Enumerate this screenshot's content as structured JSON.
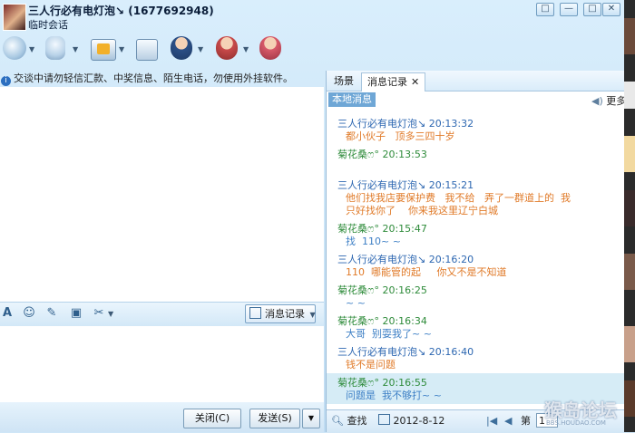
{
  "window": {
    "title": "三人行必有电灯泡↘ (1677692948)",
    "subtitle": "临时会话",
    "controls": [
      "□",
      "—",
      "□",
      "✕"
    ]
  },
  "toolbar": {
    "icons": [
      "video-call-icon",
      "voice-call-icon",
      "transfer-file-icon",
      "app-icon",
      "police-icon",
      "block-user-icon",
      "add-friend-icon"
    ]
  },
  "left": {
    "notice": "交谈中请勿轻信汇款、中奖信息、陌生电话，勿使用外挂软件。",
    "format_icons": [
      "A",
      "☺",
      "✎",
      "▣",
      "✂"
    ],
    "message_record_button": "消息记录",
    "close_button": "关闭(C)",
    "send_button": "发送(S)"
  },
  "right": {
    "tabs": [
      "场景",
      "消息记录"
    ],
    "tab_close": "✕",
    "local_tag": "本地消息",
    "more": "更多",
    "messages": [
      {
        "sender": "三人行必有电灯泡↘",
        "time": "20:13:32",
        "text": "都小伙子   顶多三四十岁",
        "who": "me"
      },
      {
        "sender": "菊花桑ෆ°",
        "time": "20:13:53",
        "text": "",
        "who": "other"
      },
      {
        "sender": "三人行必有电灯泡↘",
        "time": "20:15:21",
        "text": "他们找我店要保护费   我不给   弄了一群道上的  我\n只好找你了    你来我这里辽宁白城",
        "who": "me"
      },
      {
        "sender": "菊花桑ෆ°",
        "time": "20:15:47",
        "text": "找  110~ ~",
        "who": "other"
      },
      {
        "sender": "三人行必有电灯泡↘",
        "time": "20:16:20",
        "text": "110  哪能管的起     你又不是不知道",
        "who": "me"
      },
      {
        "sender": "菊花桑ෆ°",
        "time": "20:16:25",
        "text": "~ ~",
        "who": "other"
      },
      {
        "sender": "菊花桑ෆ°",
        "time": "20:16:34",
        "text": "大哥  别耍我了~ ~",
        "who": "other"
      },
      {
        "sender": "三人行必有电灯泡↘",
        "time": "20:16:40",
        "text": "钱不是问题",
        "who": "me"
      },
      {
        "sender": "菊花桑ෆ°",
        "time": "20:16:55",
        "text": "问题是  我不够打~ ~",
        "who": "other"
      }
    ],
    "bottom": {
      "search": "查找",
      "date": "2012-8-12",
      "page_label": "第",
      "page_value": "1"
    }
  },
  "watermark": {
    "title": "猴岛论坛",
    "url": "BBS.HOUDAO.COM"
  },
  "colors": {
    "self_sender": "#2d67b1",
    "other_sender": "#2e8b3a",
    "self_text": "#e07a28",
    "other_text": "#3d7fc5"
  }
}
